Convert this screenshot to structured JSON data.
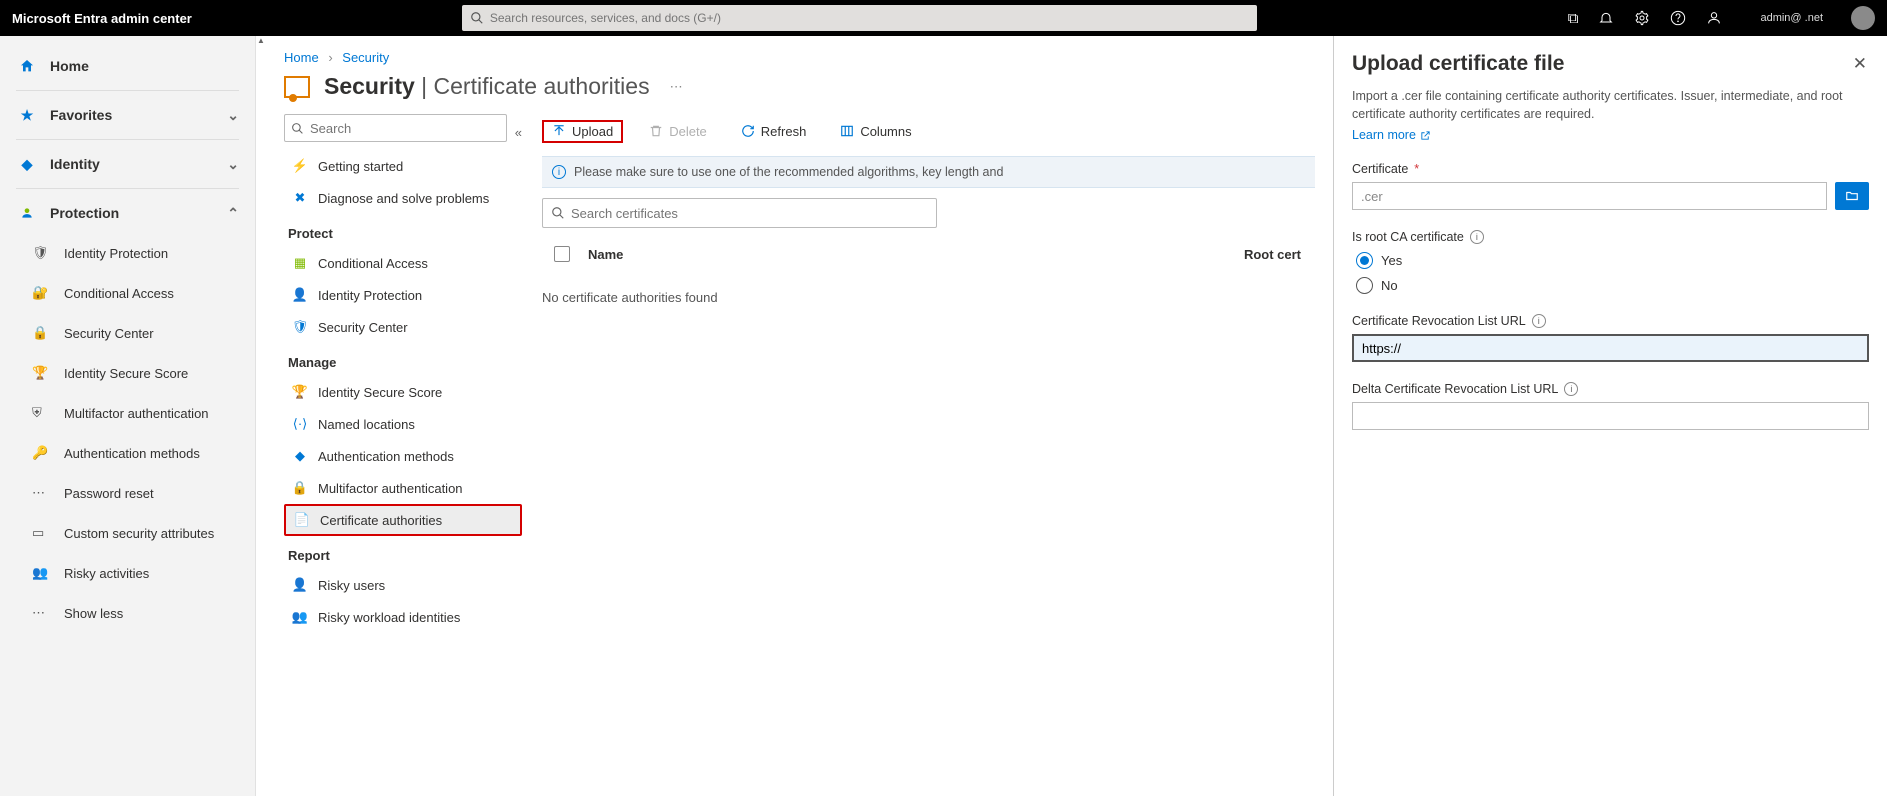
{
  "brand": "Microsoft Entra admin center",
  "search_placeholder": "Search resources, services, and docs (G+/)",
  "user_email": "admin@ .net",
  "nav1": {
    "home": "Home",
    "favorites": "Favorites",
    "identity": "Identity",
    "protection": "Protection",
    "subs": [
      "Identity Protection",
      "Conditional Access",
      "Security Center",
      "Identity Secure Score",
      "Multifactor authentication",
      "Authentication methods",
      "Password reset",
      "Custom security attributes",
      "Risky activities",
      "Show less"
    ]
  },
  "breadcrumb": {
    "home": "Home",
    "security": "Security"
  },
  "title_prefix": "Security",
  "title_suffix": "Certificate authorities",
  "nav2": {
    "search_placeholder": "Search",
    "getting_started": "Getting started",
    "diagnose": "Diagnose and solve problems",
    "section_protect": "Protect",
    "conditional_access": "Conditional Access",
    "identity_protection": "Identity Protection",
    "security_center": "Security Center",
    "section_manage": "Manage",
    "secure_score": "Identity Secure Score",
    "named_locations": "Named locations",
    "auth_methods": "Authentication methods",
    "mfa": "Multifactor authentication",
    "cert_auth": "Certificate authorities",
    "section_report": "Report",
    "risky_users": "Risky users",
    "risky_workload": "Risky workload identities"
  },
  "cmd": {
    "upload": "Upload",
    "delete": "Delete",
    "refresh": "Refresh",
    "columns": "Columns"
  },
  "banner": "Please make sure to use one of the recommended algorithms, key length and",
  "cert_search_placeholder": "Search certificates",
  "table": {
    "col_name": "Name",
    "col_root": "Root cert",
    "empty": "No certificate authorities found"
  },
  "panel": {
    "title": "Upload certificate file",
    "help": "Import a .cer file containing certificate authority certificates. Issuer, intermediate, and root certificate authority certificates are required.",
    "learn_more": "Learn more",
    "cert_label": "Certificate",
    "cert_placeholder": ".cer",
    "is_root_label": "Is root CA certificate",
    "yes": "Yes",
    "no": "No",
    "crl_label": "Certificate Revocation List URL",
    "crl_value": "https://",
    "delta_crl_label": "Delta Certificate Revocation List URL"
  }
}
